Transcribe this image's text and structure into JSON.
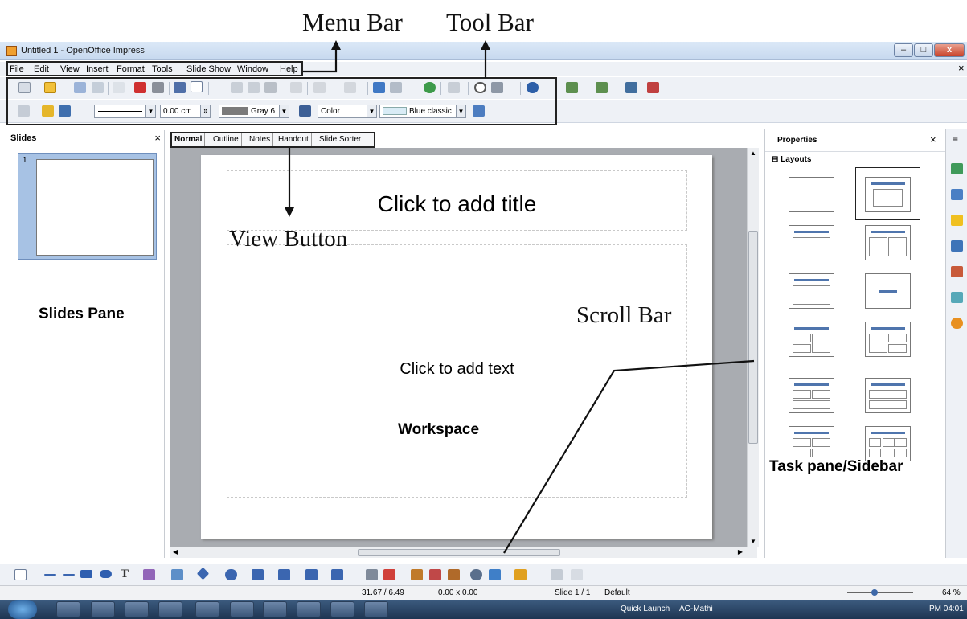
{
  "annotations": {
    "menu_bar": "Menu Bar",
    "tool_bar": "Tool Bar",
    "view_button": "View Button",
    "slides_pane": "Slides Pane",
    "scroll_bar": "Scroll Bar",
    "workspace": "Workspace",
    "task_pane": "Task pane/Sidebar"
  },
  "window": {
    "title": "Untitled 1 - OpenOffice Impress",
    "minimize": "–",
    "maximize": "□",
    "close": "x",
    "doc_close": "×"
  },
  "menu": {
    "items": [
      "File",
      "Edit",
      "View",
      "Insert",
      "Format",
      "Tools",
      "Slide Show",
      "Window",
      "Help"
    ]
  },
  "toolbar": {
    "line_width": "0.00 cm",
    "line_color": "Gray 6",
    "area_style": "Color",
    "area_fill": "Blue classic"
  },
  "slides_pane": {
    "title": "Slides",
    "close": "×",
    "slide_number": "1"
  },
  "view_tabs": [
    "Normal",
    "Outline",
    "Notes",
    "Handout",
    "Slide Sorter"
  ],
  "slide": {
    "title_placeholder": "Click to add title",
    "text_placeholder": "Click to add text"
  },
  "sidebar": {
    "title": "Properties",
    "close": "×",
    "menu": "≡",
    "section": "⊟ Layouts"
  },
  "statusbar": {
    "position": "31.67 / 6.49",
    "size": "0.00 x 0.00",
    "slide": "Slide 1 / 1",
    "master": "Default",
    "zoom": "64 %"
  },
  "taskbar": {
    "quick_launch": "Quick Launch",
    "user": "AC-Mathi",
    "time": "PM 04:01"
  }
}
